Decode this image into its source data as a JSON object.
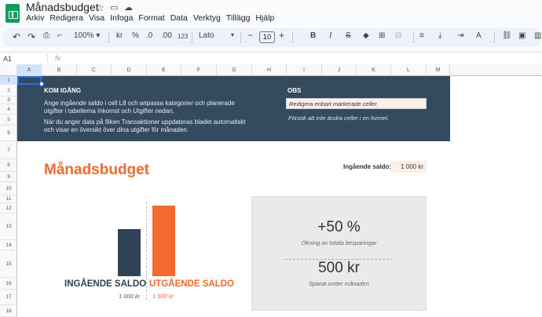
{
  "app": {
    "doc_title": "Månadsbudget",
    "menu": [
      "Arkiv",
      "Redigera",
      "Visa",
      "Infoga",
      "Format",
      "Data",
      "Verktyg",
      "Tillägg",
      "Hjälp"
    ]
  },
  "toolbar": {
    "zoom": "100%",
    "currency": "kr",
    "percent": "%",
    "dec_decrease": ".0",
    "dec_increase": ".00",
    "number_format": "123",
    "font": "Lato",
    "font_size": "10",
    "bold": "B",
    "italic": "I",
    "strike": "S",
    "text_color": "A"
  },
  "formula_bar": {
    "cell_ref": "A1",
    "fx": "fx"
  },
  "columns": [
    "A",
    "B",
    "C",
    "D",
    "E",
    "F",
    "G",
    "H",
    "I",
    "J",
    "K",
    "L",
    "M"
  ],
  "rows": [
    "1",
    "2",
    "3",
    "4",
    "5",
    "6",
    "7",
    "8",
    "9",
    "10",
    "11",
    "12",
    "13",
    "14",
    "15",
    "16",
    "17",
    "18"
  ],
  "banner": {
    "heading": "KOM IGÅNG",
    "line1": "Ange ingående saldo i cell L8 och anpassa kategorier och planerade",
    "line2": "utgifter i tabellerna Inkomst och Utgifter nedan.",
    "line3": "När du anger data på fliken Transaktioner uppdateras bladet automatiskt",
    "line4": "och visar en översikt över dina utgifter för månaden.",
    "obs_heading": "OBS",
    "obs_box": "Redigera enbart markerade celler.",
    "obs_note": "Försök att inte ändra celler i en formel."
  },
  "budget": {
    "title": "Månadsbudget",
    "opening_label": "Ingående saldo:",
    "opening_value": "1 000 kr",
    "bar_in_label": "INGÅENDE SALDO",
    "bar_out_label": "UTGÅENDE SALDO",
    "bar_in_value": "1 000 kr",
    "bar_out_value": "1 500 kr",
    "savings_pct": "+50 %",
    "savings_pct_label": "Ökning av totala besparingar",
    "saved": "500 kr",
    "saved_label": "Sparat under månaden"
  },
  "chart_data": {
    "type": "bar",
    "categories": [
      "INGÅENDE SALDO",
      "UTGÅENDE SALDO"
    ],
    "values": [
      1000,
      1500
    ],
    "colors": [
      "#2f4256",
      "#f26a2e"
    ]
  }
}
